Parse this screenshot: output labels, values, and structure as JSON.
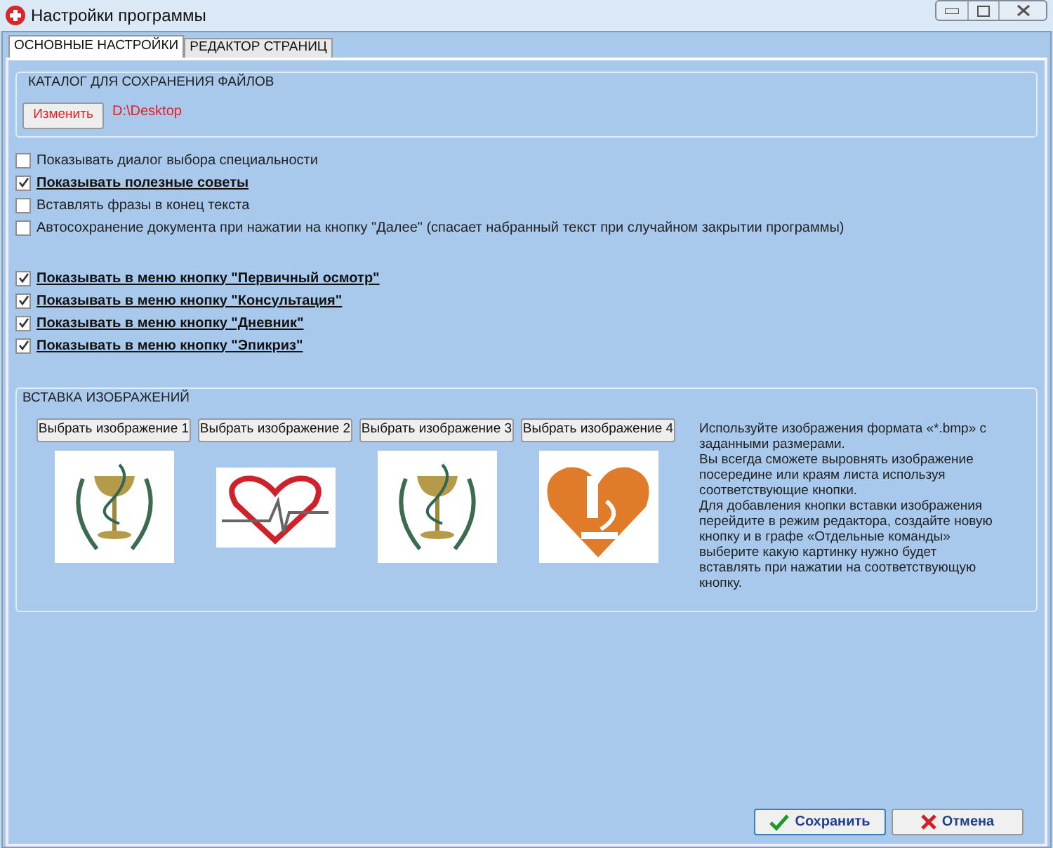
{
  "window": {
    "title": "Настройки программы"
  },
  "tabs": [
    {
      "label": "ОСНОВНЫЕ НАСТРОЙКИ",
      "selected": true
    },
    {
      "label": "РЕДАКТОР СТРАНИЦ",
      "selected": false
    }
  ],
  "catalog": {
    "title": "КАТАЛОГ ДЛЯ СОХРАНЕНИЯ ФАЙЛОВ",
    "button": "Изменить",
    "path": "D:\\Desktop"
  },
  "options": [
    {
      "label": "Показывать диалог выбора специальности",
      "checked": false
    },
    {
      "label": "Показывать полезные советы",
      "checked": true
    },
    {
      "label": "Вставлять фразы в конец текста",
      "checked": false
    },
    {
      "label": "Автосохранение документа при нажатии на кнопку \"Далее\" (спасает набранный текст при случайном закрытии программы)",
      "checked": false
    }
  ],
  "menu_options": [
    {
      "label": "Показывать в меню кнопку \"Первичный осмотр\"",
      "checked": true
    },
    {
      "label": "Показывать в меню кнопку \"Консультация\"",
      "checked": true
    },
    {
      "label": "Показывать в меню кнопку \"Дневник\"",
      "checked": true
    },
    {
      "label": "Показывать в меню кнопку \"Эпикриз\"",
      "checked": true
    }
  ],
  "images": {
    "title": "ВСТАВКА ИЗОБРАЖЕНИЙ",
    "slots": [
      {
        "button": "Выбрать изображение 1",
        "kind": "cup"
      },
      {
        "button": "Выбрать изображение 2",
        "kind": "heart-pulse"
      },
      {
        "button": "Выбрать изображение 3",
        "kind": "cup"
      },
      {
        "button": "Выбрать изображение 4",
        "kind": "heart-microscope"
      }
    ],
    "help": [
      "Используйте изображения формата «*.bmp» с заданными размерами.",
      "Вы всегда сможете выровнять изображение посередине или краям листа используя соответствующие кнопки.",
      "Для добавления кнопки вставки изображения перейдите в режим редактора, создайте новую кнопку и в графе «Отдельные команды» выберите какую картинку нужно будет вставлять при нажатии на соответствующую кнопку."
    ]
  },
  "buttons": [
    {
      "label": "Сохранить",
      "kind": "save"
    },
    {
      "label": "Отмена",
      "kind": "cancel"
    }
  ]
}
